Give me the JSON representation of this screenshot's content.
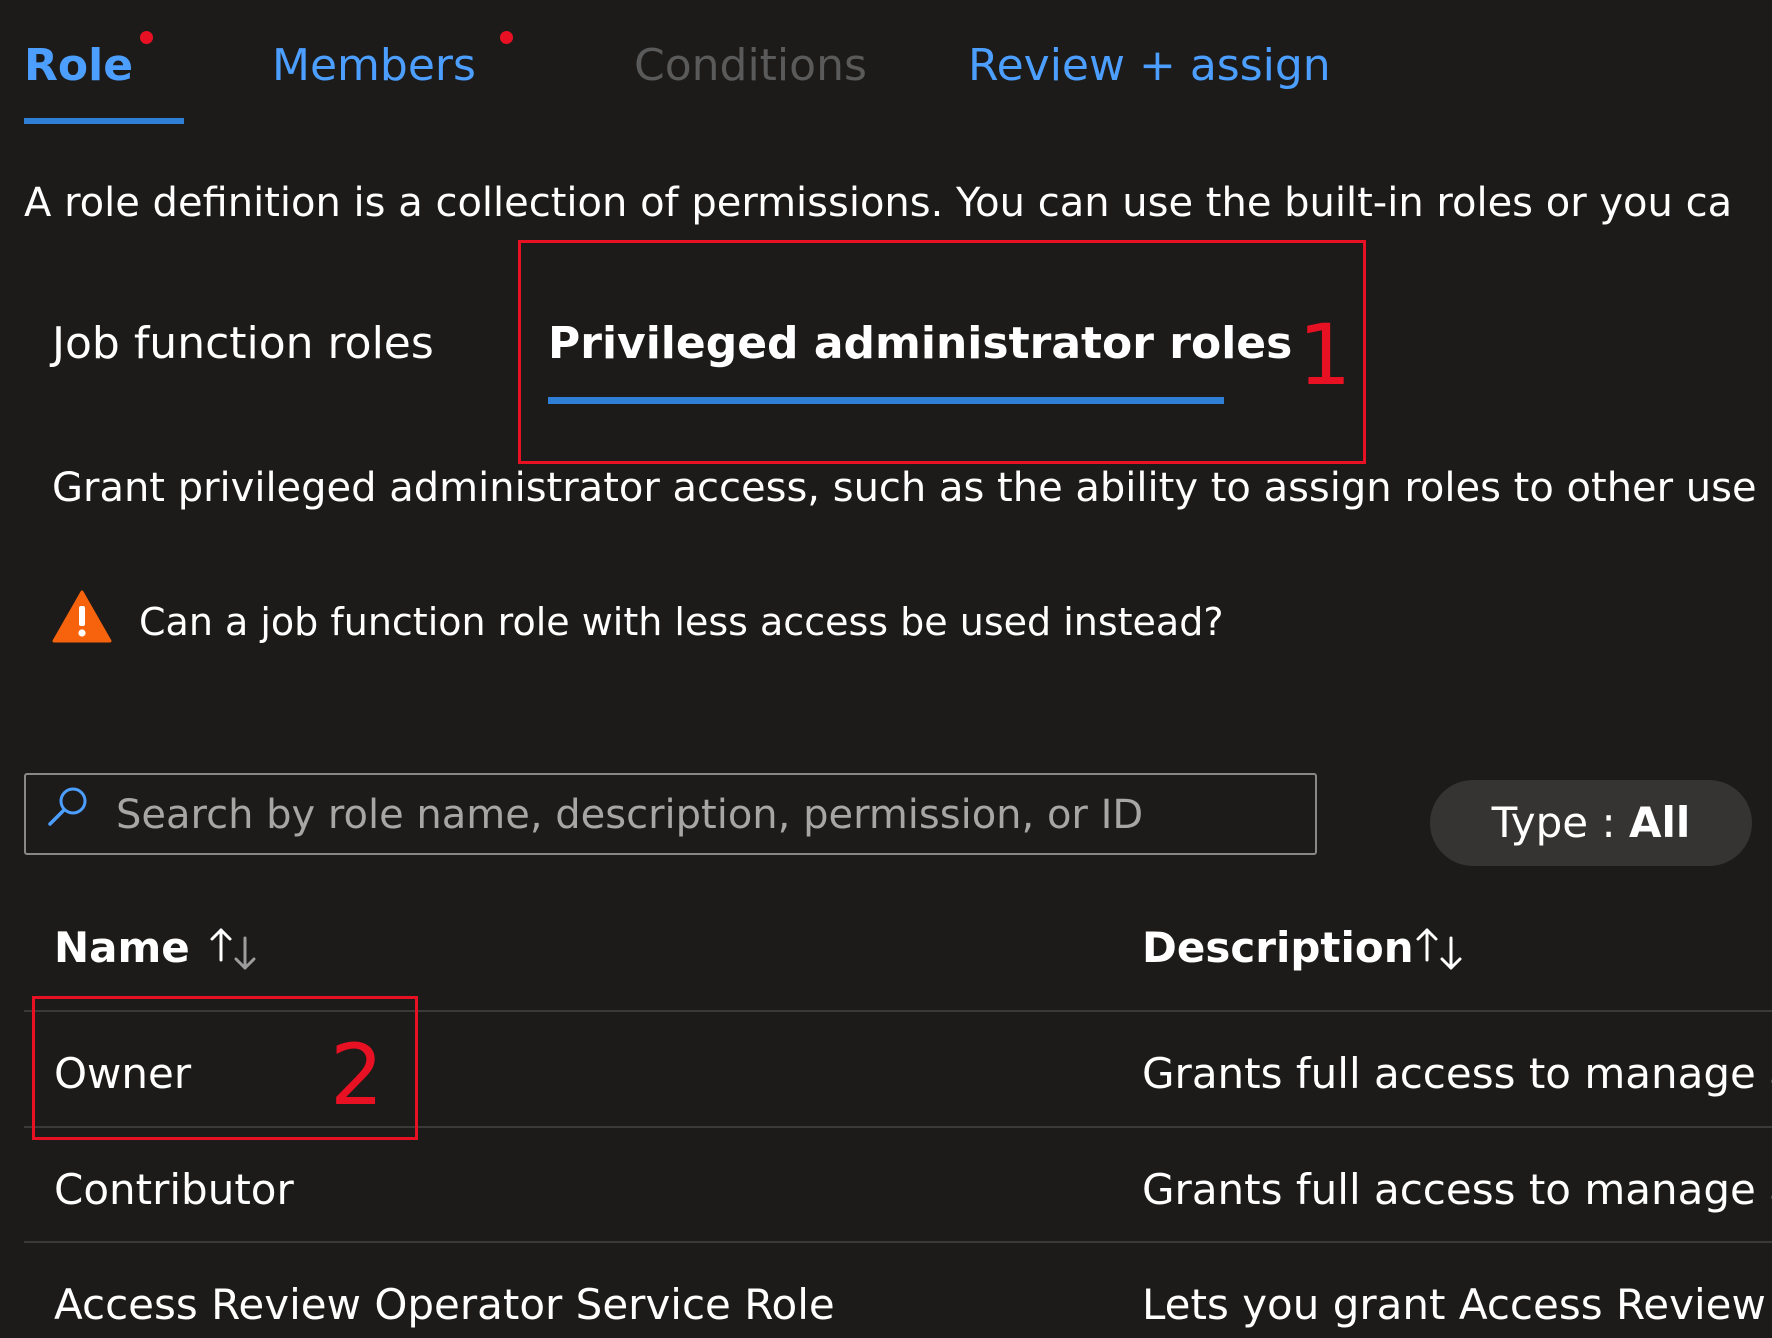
{
  "wizard_tabs": {
    "role": "Role",
    "members": "Members",
    "conditions": "Conditions",
    "review": "Review + assign"
  },
  "description": "A role definition is a collection of permissions. You can use the built-in roles or you ca",
  "sub_tabs": {
    "job_function": "Job function roles",
    "privileged": "Privileged administrator roles"
  },
  "privileged_description": "Grant privileged administrator access, such as the ability to assign roles to other use",
  "warning": "Can a job function role with less access be used instead?",
  "search": {
    "placeholder": "Search by role name, description, permission, or ID"
  },
  "type_filter": {
    "label": "Type : ",
    "value": "All"
  },
  "table": {
    "columns": [
      "Name",
      "Description"
    ],
    "rows": [
      {
        "name": "Owner",
        "description": "Grants full access to manage al"
      },
      {
        "name": "Contributor",
        "description": "Grants full access to manage al"
      },
      {
        "name": "Access Review Operator Service Role",
        "description": "Lets you grant Access Review S"
      }
    ]
  },
  "annotations": [
    "1",
    "2"
  ],
  "colors": {
    "background": "#1c1b1a",
    "accent": "#2f7fd6",
    "link": "#4c9eff",
    "annotation": "#e81123",
    "warning": "#f7630c"
  }
}
